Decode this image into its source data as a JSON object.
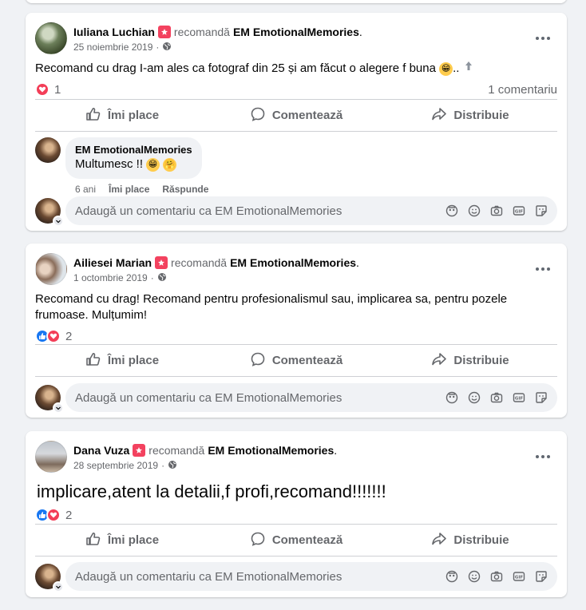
{
  "posts": [
    {
      "author": "Iuliana Luchian",
      "recommends": "recomandă",
      "page": "EM EmotionalMemories",
      "date": "25 noiembrie 2019",
      "dot": "·",
      "text": "Recomand cu drag I-am ales ca fotograf din 25 și am făcut o alegere f buna",
      "text_suffix": "..",
      "reaction_count": "1",
      "comments_count": "1 comentariu",
      "actions": {
        "like": "Îmi place",
        "comment": "Comentează",
        "share": "Distribuie"
      },
      "comment": {
        "name": "EM EmotionalMemories",
        "text": "Multumesc !!",
        "time": "6 ani",
        "like": "Îmi place",
        "reply": "Răspunde"
      },
      "compose_placeholder": "Adaugă un comentariu ca EM EmotionalMemories"
    },
    {
      "author": "Ailiesei Marian",
      "recommends": "recomandă",
      "page": "EM EmotionalMemories",
      "date": "1 octombrie 2019",
      "dot": "·",
      "text": "Recomand cu drag! Recomand pentru profesionalismul sau, implicarea sa, pentru pozele frumoase. Mulțumim!",
      "reaction_count": "2",
      "actions": {
        "like": "Îmi place",
        "comment": "Comentează",
        "share": "Distribuie"
      },
      "compose_placeholder": "Adaugă un comentariu ca EM EmotionalMemories"
    },
    {
      "author": "Dana Vuza",
      "recommends": "recomandă",
      "page": "EM EmotionalMemories",
      "date": "28 septembrie 2019",
      "dot": "·",
      "text": "implicare,atent la detalii,f profi,recomand!!!!!!!",
      "reaction_count": "2",
      "actions": {
        "like": "Îmi place",
        "comment": "Comentează",
        "share": "Distribuie"
      },
      "compose_placeholder": "Adaugă un comentariu ca EM EmotionalMemories"
    }
  ],
  "colors": {
    "background": "#f0f2f5",
    "secondary_text": "#65676b",
    "love": "#f33e58",
    "like": "#1877f2",
    "recommend_badge": "#f3425f"
  },
  "icons": [
    "recommend-icon",
    "globe-icon",
    "more-icon",
    "like-icon",
    "comment-icon",
    "share-icon",
    "avatar-icon",
    "sticker-icon",
    "emoji-icon",
    "camera-icon",
    "gif-icon",
    "sticker-face-icon"
  ]
}
